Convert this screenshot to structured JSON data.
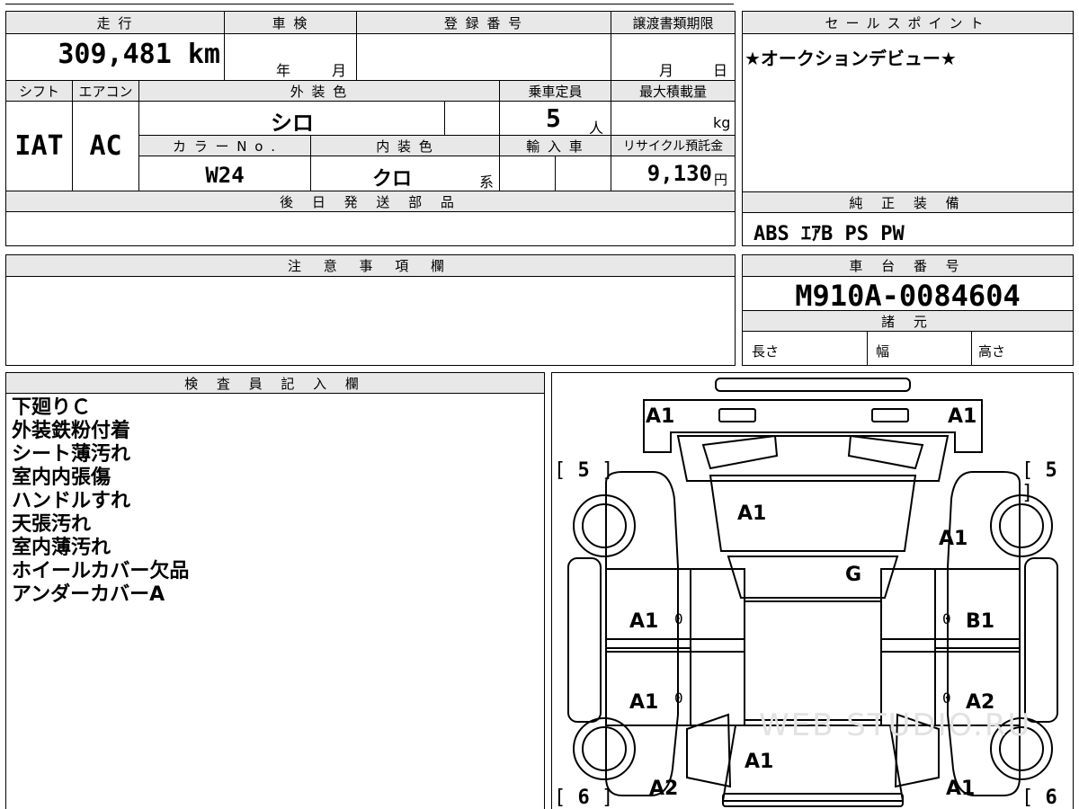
{
  "spec": {
    "mileage_label": "走 行",
    "mileage_value": "309,481 km",
    "inspection_label": "車 検",
    "inspection_year": "年",
    "inspection_month": "月",
    "registration_label": "登 録 番 号",
    "transfer_label": "譲渡書類期限",
    "transfer_month": "月",
    "transfer_day": "日",
    "shift_label": "シフト",
    "shift_value": "IAT",
    "ac_label": "エアコン",
    "ac_value": "AC",
    "exterior_label": "外 装 色",
    "exterior_value": "シロ",
    "capacity_label": "乗車定員",
    "capacity_value": "5",
    "capacity_unit": "人",
    "max_load_label": "最大積載量",
    "max_load_unit": "kg",
    "color_no_label": "カ ラ ー N o .",
    "color_no_value": "W24",
    "interior_label": "内 装 色",
    "interior_value": "クロ",
    "interior_suffix": "系",
    "import_label": "輸 入 車",
    "recycle_label": "リサイクル預託金",
    "recycle_value": "9,130",
    "recycle_unit": "円",
    "later_parts_label": "後 日 発 送 部 品"
  },
  "sales": {
    "label": "セールスポイント",
    "text": "★オークションデビュー★"
  },
  "equipment": {
    "label": "純 正 装 備",
    "text": "ABS ｴｱB PS PW"
  },
  "notes": {
    "label": "注 意 事 項 欄"
  },
  "chassis": {
    "label": "車 台 番 号",
    "value": "M910A-0084604",
    "spec_label": "諸 元",
    "length_label": "長さ",
    "width_label": "幅",
    "height_label": "高さ"
  },
  "inspector": {
    "label": "検 査 員 記 入 欄",
    "lines": [
      "下廻りＣ",
      "外装鉄粉付着",
      "シート薄汚れ",
      "室内内張傷",
      "ハンドルすれ",
      "天張汚れ",
      "室内薄汚れ",
      "ホイールカバー欠品",
      "アンダーカバーA"
    ]
  },
  "diagram": {
    "front_left": "A1",
    "front_right": "A1",
    "windshield": "A1",
    "fender_right": "A1",
    "roof": "G",
    "door_fl": "A1",
    "door_fr": "B1",
    "door_rl": "A1",
    "door_rr": "A2",
    "rear_glass": "A1",
    "rear_left": "A2",
    "rear_right": "A1",
    "tire_front_left": "5",
    "tire_front_right": "5",
    "tire_rear_left": "6",
    "tire_rear_right": "6",
    "zero_mark": "0",
    "watermark": "WEB STUDIO.RU"
  }
}
